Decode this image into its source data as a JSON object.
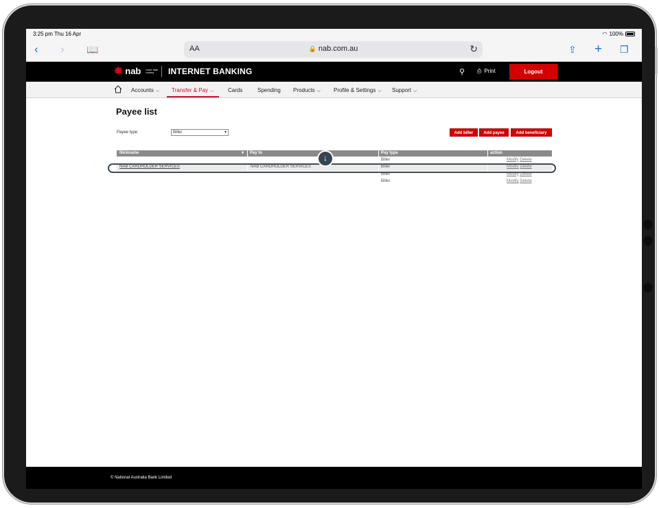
{
  "status": {
    "time": "3:25 pm  Thu 16 Apr",
    "battery": "100%"
  },
  "browser": {
    "aa": "AA",
    "url": "nab.com.au",
    "lock": "🔒"
  },
  "header": {
    "brand": "nab",
    "tagline": "more than money",
    "title": "INTERNET BANKING",
    "print": "Print",
    "logout": "Logout"
  },
  "nav": {
    "items": [
      {
        "label": "Accounts",
        "chevron": true
      },
      {
        "label": "Transfer & Pay",
        "chevron": true,
        "active": true
      },
      {
        "label": "Cards",
        "chevron": false
      },
      {
        "label": "Spending",
        "chevron": false
      },
      {
        "label": "Products",
        "chevron": true
      },
      {
        "label": "Profile & Settings",
        "chevron": true
      },
      {
        "label": "Support",
        "chevron": true
      }
    ]
  },
  "page": {
    "title": "Payee list",
    "filter_label": "Payee type:",
    "filter_value": "Biller",
    "buttons": {
      "add_biller": "Add biller",
      "add_payee": "Add payee",
      "add_beneficiary": "Add beneficiary"
    }
  },
  "table": {
    "headers": {
      "nickname": "Nickname",
      "pay_to": "Pay to",
      "pay_type": "Pay type",
      "action": "action"
    },
    "rows": [
      {
        "nickname": "",
        "pay_to": "",
        "pay_type": "Biller",
        "modify": "Modify",
        "delete": "Delete"
      },
      {
        "nickname": "NAB CARDHOLDER SERVICES",
        "pay_to": "NAB CARDHOLDER SERVICES",
        "pay_type": "Biller",
        "modify": "Modify",
        "delete": "Delete"
      },
      {
        "nickname": "",
        "pay_to": "",
        "pay_type": "Biller",
        "modify": "Modify",
        "delete": "Delete"
      },
      {
        "nickname": "",
        "pay_to": "",
        "pay_type": "Biller",
        "modify": "Modify",
        "delete": "Delete"
      }
    ]
  },
  "footer": {
    "copyright": "© National Australia Bank Limited"
  }
}
